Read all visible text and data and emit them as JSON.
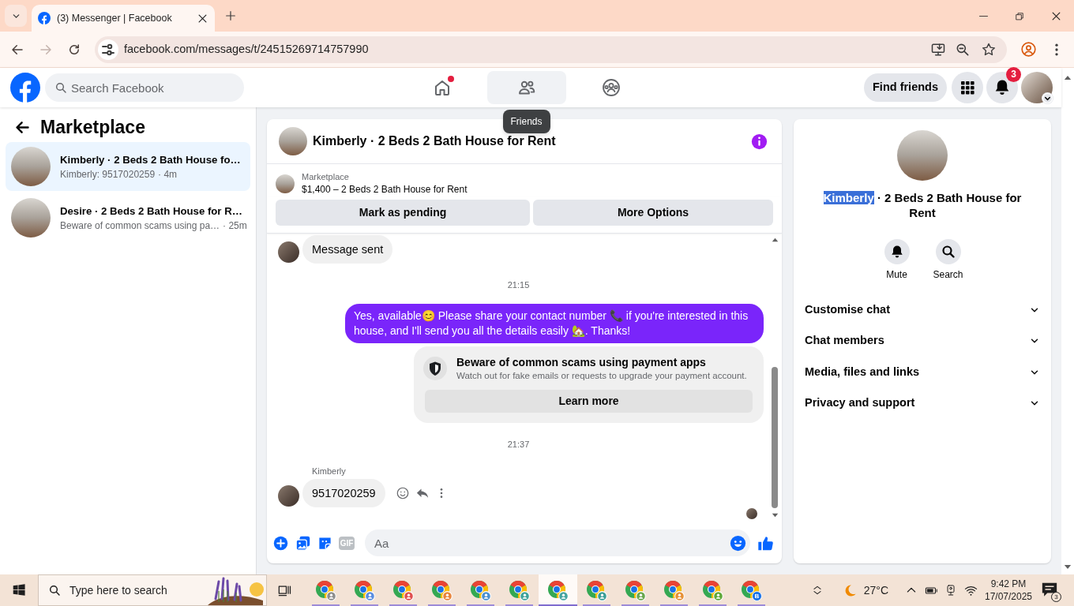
{
  "browser": {
    "tab": {
      "title": "(3) Messenger | Facebook"
    },
    "nav_buttons": [
      {
        "kind": "back",
        "disabled": false
      },
      {
        "kind": "forward",
        "disabled": true
      },
      {
        "kind": "reload",
        "disabled": false
      }
    ],
    "url": "facebook.com/messages/t/24515269714757990"
  },
  "header": {
    "search": {
      "placeholder": "Search Facebook"
    },
    "nav": [
      {
        "kind": "home",
        "hovered": false,
        "dot": true
      },
      {
        "kind": "friends",
        "hovered": true,
        "dot": false
      },
      {
        "kind": "groups",
        "hovered": false,
        "dot": false
      }
    ],
    "tooltip": "Friends",
    "find_friends": "Find friends",
    "notification_count": "3"
  },
  "sidebar": {
    "title": "Marketplace",
    "conversations": [
      {
        "title": "Kimberly · 2 Beds 2 Bath House fo…",
        "preview": "Kimberly: 9517020259",
        "time": "· 4m",
        "selected": true
      },
      {
        "title": "Desire · 2 Beds 2 Bath House for R…",
        "preview": "Beware of common scams using pa…",
        "time": "· 25m",
        "selected": false
      }
    ]
  },
  "chat": {
    "title": "Kimberly · 2 Beds 2 Bath House for Rent",
    "listing": {
      "label": "Marketplace",
      "title": "$1,400 – 2 Beds 2 Bath House for Rent"
    },
    "actions": [
      "Mark as pending",
      "More Options"
    ],
    "messages": [
      {
        "kind": "incoming",
        "text": "Message sent",
        "show_actions": false
      },
      {
        "kind": "time",
        "text": "21:15"
      },
      {
        "kind": "outgoing",
        "text": "Yes, available😊 Please share your contact number 📞 if you're interested in this house, and I'll send you all the details easily 🏡. Thanks!"
      },
      {
        "kind": "notice",
        "title": "Beware of common scams using payment apps",
        "text": "Watch out for fake emails or requests to upgrade your payment account.",
        "button": "Learn more"
      },
      {
        "kind": "time",
        "text": "21:37"
      },
      {
        "kind": "incoming",
        "sender": "Kimberly",
        "text": "9517020259",
        "show_actions": true
      }
    ],
    "read_receipt": true,
    "composer": {
      "gif": "GIF",
      "placeholder": "Aa"
    }
  },
  "details": {
    "title_parts": [
      {
        "text": "Kimberly",
        "highlighted": true
      },
      {
        "text": "· 2 Beds 2 Bath House for Rent",
        "highlighted": false
      }
    ],
    "actions": [
      {
        "kind": "mute",
        "label": "Mute"
      },
      {
        "kind": "search",
        "label": "Search"
      }
    ],
    "sections": [
      {
        "label": "Customise chat",
        "expanded": false
      },
      {
        "label": "Chat members",
        "expanded": false
      },
      {
        "label": "Media, files and links",
        "expanded": false
      },
      {
        "label": "Privacy and support",
        "expanded": false
      }
    ]
  },
  "taskbar": {
    "search": {
      "placeholder": "Type here to search"
    },
    "apps": [
      {
        "color": "#8e8e8e",
        "selected": false
      },
      {
        "color": "#5a8de0",
        "selected": false
      },
      {
        "color": "#e05050",
        "selected": false
      },
      {
        "color": "#e8843c",
        "selected": false
      },
      {
        "color": "#4a90d0",
        "selected": false
      },
      {
        "color": "#3fa39a",
        "selected": false
      },
      {
        "color": "#45a5a0",
        "selected": true
      },
      {
        "color": "#3a9e98",
        "selected": false
      },
      {
        "color": "#6aa84f",
        "selected": false
      },
      {
        "color": "#e69138",
        "selected": false
      },
      {
        "color": "#5ea83a",
        "selected": false
      },
      {
        "color": "#1a73e8",
        "selected": false,
        "badge_text": "B"
      }
    ],
    "weather": "27°C",
    "time": "9:42 PM",
    "date": "17/07/2025",
    "notification_count": "3"
  }
}
